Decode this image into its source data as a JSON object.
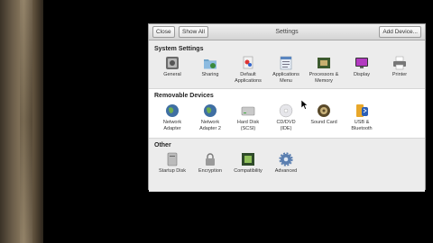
{
  "window": {
    "title": "Settings",
    "close_label": "Close",
    "show_all_label": "Show All",
    "add_device_label": "Add Device..."
  },
  "sections": [
    {
      "title": "System Settings",
      "items": [
        {
          "label": "General",
          "icon": "general-icon"
        },
        {
          "label": "Sharing",
          "icon": "sharing-folder-icon"
        },
        {
          "label": "Default\nApplications",
          "icon": "default-applications-icon"
        },
        {
          "label": "Applications\nMenu",
          "icon": "applications-menu-icon"
        },
        {
          "label": "Processors &\nMemory",
          "icon": "processor-chip-icon"
        },
        {
          "label": "Display",
          "icon": "display-monitor-icon"
        },
        {
          "label": "Printer",
          "icon": "printer-icon"
        }
      ]
    },
    {
      "title": "Removable Devices",
      "items": [
        {
          "label": "Network\nAdapter",
          "icon": "network-globe-icon"
        },
        {
          "label": "Network\nAdapter 2",
          "icon": "network-globe-icon"
        },
        {
          "label": "Hard Disk\n(SCSI)",
          "icon": "hard-disk-icon"
        },
        {
          "label": "CD/DVD\n(IDE)",
          "icon": "optical-disc-icon"
        },
        {
          "label": "Sound Card",
          "icon": "speaker-icon"
        },
        {
          "label": "USB &\nBluetooth",
          "icon": "usb-bluetooth-icon"
        }
      ]
    },
    {
      "title": "Other",
      "items": [
        {
          "label": "Startup Disk",
          "icon": "startup-disk-icon"
        },
        {
          "label": "Encryption",
          "icon": "lock-icon"
        },
        {
          "label": "Compatibility",
          "icon": "compatibility-chip-icon"
        },
        {
          "label": "Advanced",
          "icon": "gear-icon"
        }
      ]
    }
  ],
  "colors": {
    "toolbar_top": "#f0f0f0",
    "toolbar_bottom": "#d4d4d4",
    "section_alt": "#ececec",
    "desktop": "#000000"
  }
}
